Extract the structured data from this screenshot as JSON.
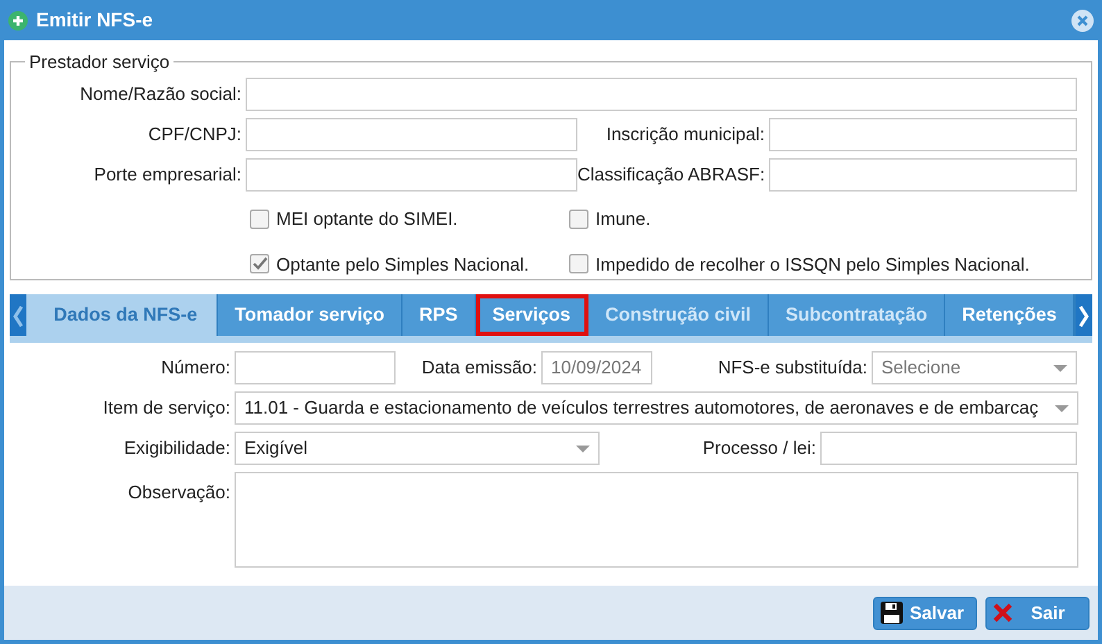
{
  "window": {
    "title": "Emitir NFS-e"
  },
  "prestador": {
    "legend": "Prestador serviço",
    "fields": [
      {
        "label": "Nome/Razão social:"
      },
      {
        "label": "CPF/CNPJ:"
      },
      {
        "label": "Inscrição municipal:"
      },
      {
        "label": "Porte empresarial:"
      },
      {
        "label": "Classificação ABRASF:"
      }
    ],
    "checkboxes": [
      {
        "label": "MEI optante do SIMEI.",
        "checked": false
      },
      {
        "label": "Imune.",
        "checked": false
      },
      {
        "label": "Optante pelo Simples Nacional.",
        "checked": true
      },
      {
        "label": "Impedido de recolher o ISSQN pelo Simples Nacional.",
        "checked": false
      }
    ]
  },
  "tabs": [
    {
      "label": "Dados da NFS-e",
      "selected": true,
      "disabled": false,
      "highlighted": false
    },
    {
      "label": "Tomador serviço",
      "selected": false,
      "disabled": false,
      "highlighted": false
    },
    {
      "label": "RPS",
      "selected": false,
      "disabled": false,
      "highlighted": false
    },
    {
      "label": "Serviços",
      "selected": false,
      "disabled": false,
      "highlighted": true
    },
    {
      "label": "Construção civil",
      "selected": false,
      "disabled": true,
      "highlighted": false
    },
    {
      "label": "Subcontratação",
      "selected": false,
      "disabled": true,
      "highlighted": false
    },
    {
      "label": "Retenções",
      "selected": false,
      "disabled": false,
      "highlighted": false
    }
  ],
  "form": {
    "numero": {
      "label": "Número:"
    },
    "data_emissao": {
      "label": "Data emissão:",
      "value": "10/09/2024",
      "disabled": true
    },
    "nfse_substituida": {
      "label": "NFS-e substituída:",
      "value": "Selecione",
      "disabled": true
    },
    "item_servico": {
      "label": "Item de serviço:",
      "value": "11.01 - Guarda e estacionamento de veículos terrestres automotores, de aeronaves e de embarcaç"
    },
    "exigibilidade": {
      "label": "Exigibilidade:",
      "value": "Exigível"
    },
    "processo": {
      "label": "Processo / lei:"
    },
    "observacao": {
      "label": "Observação:"
    }
  },
  "buttons": [
    {
      "kind": "save",
      "label": "Salvar"
    },
    {
      "kind": "exit",
      "label": "Sair"
    }
  ]
}
